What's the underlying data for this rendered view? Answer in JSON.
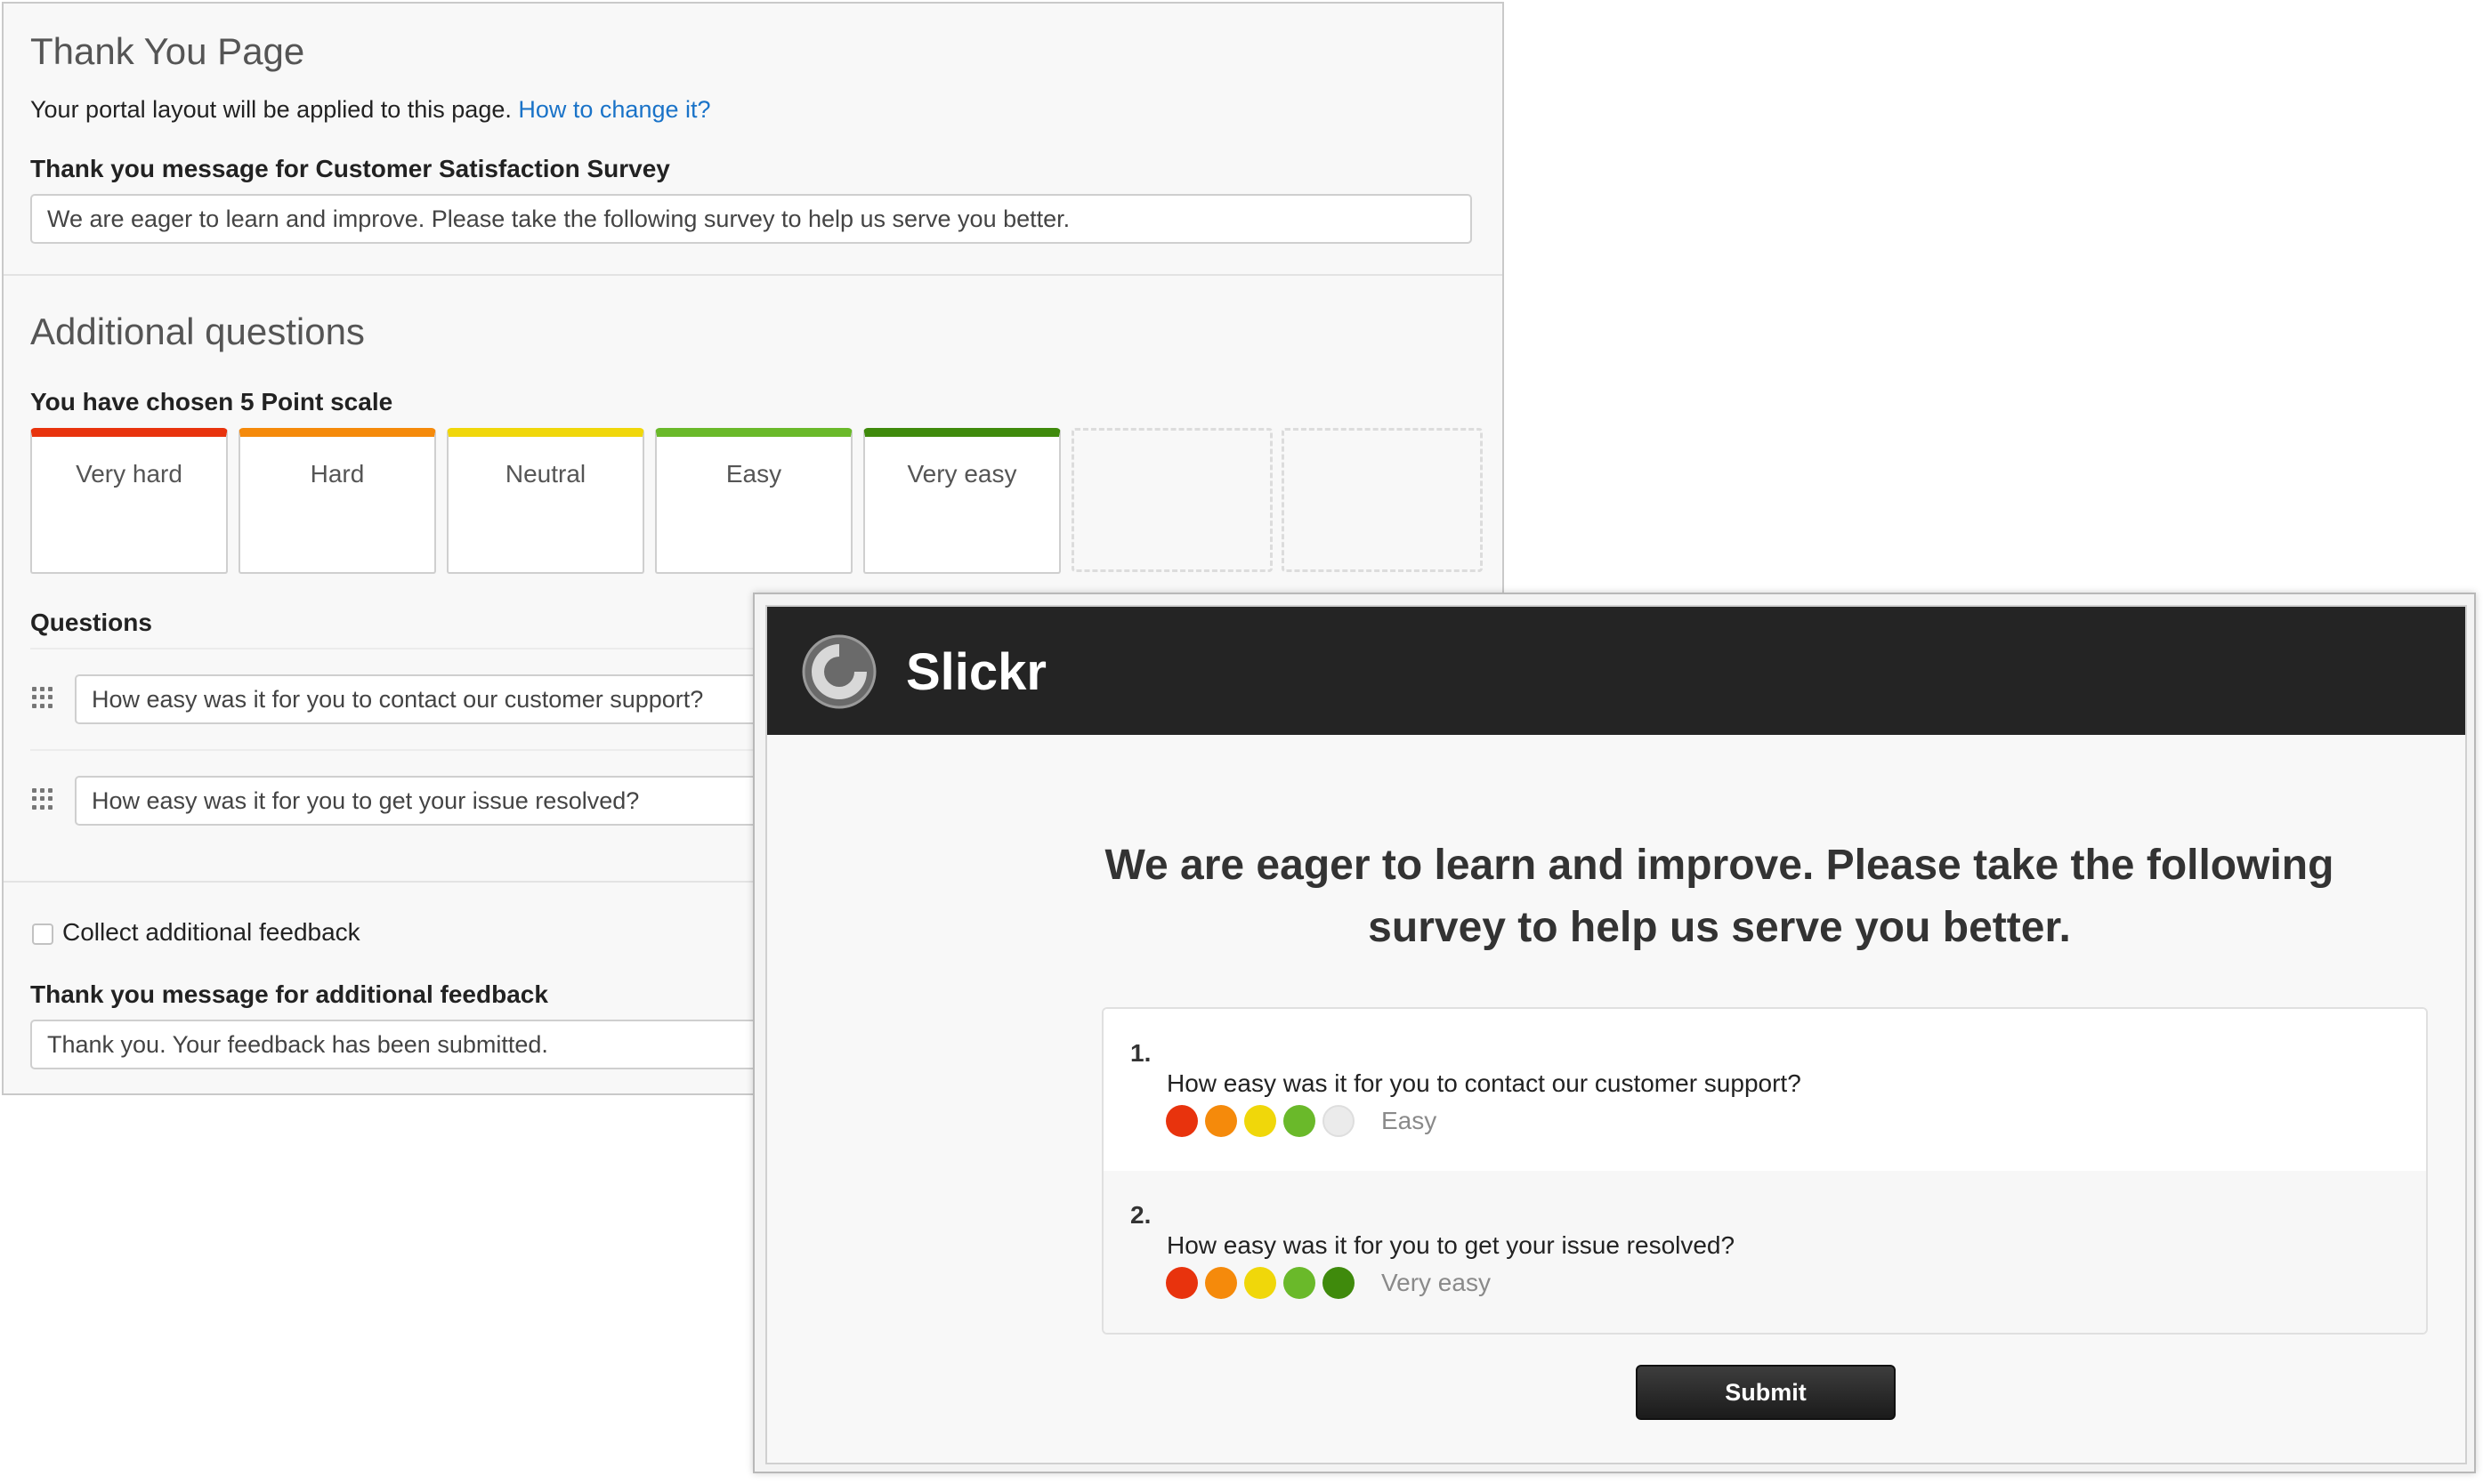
{
  "colors": {
    "very_hard": "#e8330d",
    "hard": "#f58a0b",
    "neutral": "#f0d70a",
    "easy": "#6ab92a",
    "very_easy": "#3f8a0c",
    "unselected": "#ebebeb",
    "link": "#1a73c8",
    "brand_header": "#242424"
  },
  "admin": {
    "title": "Thank You Page",
    "layout_note": "Your portal layout will be applied to this page.",
    "layout_link": "How to change it?",
    "message_label": "Thank you message for Customer Satisfaction Survey",
    "message_value": "We are eager to learn and improve. Please take the following survey to help us serve you better.",
    "additional_title": "Additional questions",
    "scale_label": "You have chosen 5 Point scale",
    "scale_items": [
      {
        "label": "Very hard",
        "color_key": "very_hard"
      },
      {
        "label": "Hard",
        "color_key": "hard"
      },
      {
        "label": "Neutral",
        "color_key": "neutral"
      },
      {
        "label": "Easy",
        "color_key": "easy"
      },
      {
        "label": "Very easy",
        "color_key": "very_easy"
      }
    ],
    "questions_label": "Questions",
    "questions": [
      "How easy was it for you to contact our customer support?",
      "How easy was it for you to get your issue resolved?"
    ],
    "collect_feedback_label": "Collect additional feedback",
    "collect_feedback_checked": false,
    "feedback_message_label": "Thank you message for additional feedback",
    "feedback_message_value": "Thank you. Your feedback has been submitted."
  },
  "preview": {
    "brand_name": "Slickr",
    "heading": "We are eager to learn and improve. Please take the following survey to help us serve you better.",
    "questions": [
      {
        "number": "1.",
        "text": "How easy was it for you to contact our customer support?",
        "rating": 4,
        "rating_label": "Easy"
      },
      {
        "number": "2.",
        "text": "How easy was it for you to get your issue resolved?",
        "rating": 5,
        "rating_label": "Very easy"
      }
    ],
    "submit_label": "Submit"
  }
}
